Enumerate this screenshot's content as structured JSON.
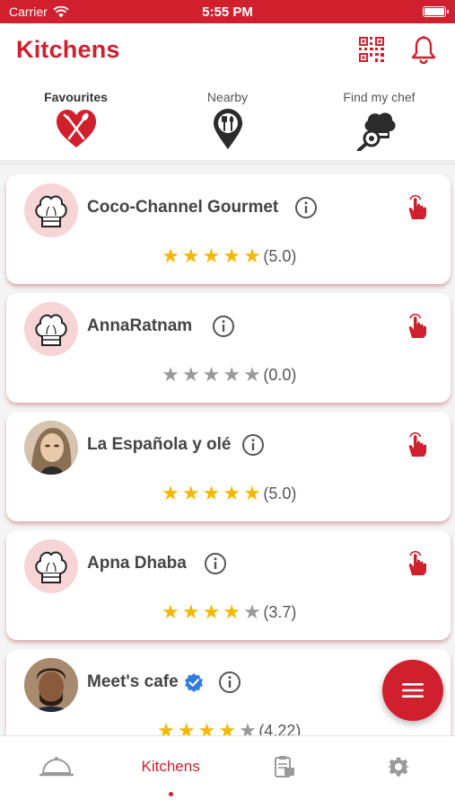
{
  "status_bar": {
    "carrier": "Carrier",
    "time": "5:55 PM"
  },
  "header": {
    "title": "Kitchens"
  },
  "categories": [
    {
      "label": "Favourites",
      "icon": "heart-cutlery-icon"
    },
    {
      "label": "Nearby",
      "icon": "location-pin-icon"
    },
    {
      "label": "Find my chef",
      "icon": "chef-search-icon"
    }
  ],
  "kitchens": [
    {
      "name": "Coco-Channel Gourmet",
      "rating": 5.0,
      "rating_text": "(5.0)",
      "avatar": "chef-hat-icon"
    },
    {
      "name": "AnnaRatnam",
      "rating": 0.0,
      "rating_text": "(0.0)",
      "avatar": "chef-hat-icon"
    },
    {
      "name": "La Española y olé",
      "rating": 5.0,
      "rating_text": "(5.0)",
      "avatar": "profile-photo"
    },
    {
      "name": "Apna Dhaba",
      "rating": 3.7,
      "rating_text": "(3.7)",
      "avatar": "chef-hat-icon"
    },
    {
      "name": "Meet's cafe",
      "rating": 4.22,
      "rating_text": "(4.22)",
      "avatar": "profile-photo",
      "verified": true
    }
  ],
  "tab_bar": {
    "tabs": [
      {
        "name": "cloche-icon",
        "label": ""
      },
      {
        "name": "kitchens",
        "label": "Kitchens"
      },
      {
        "name": "orders-icon",
        "label": ""
      },
      {
        "name": "gear-icon",
        "label": ""
      }
    ],
    "active_index": 1
  },
  "colors": {
    "brand": "#d0202e",
    "star": "#f5b800",
    "star_off": "#9a9a9a"
  }
}
